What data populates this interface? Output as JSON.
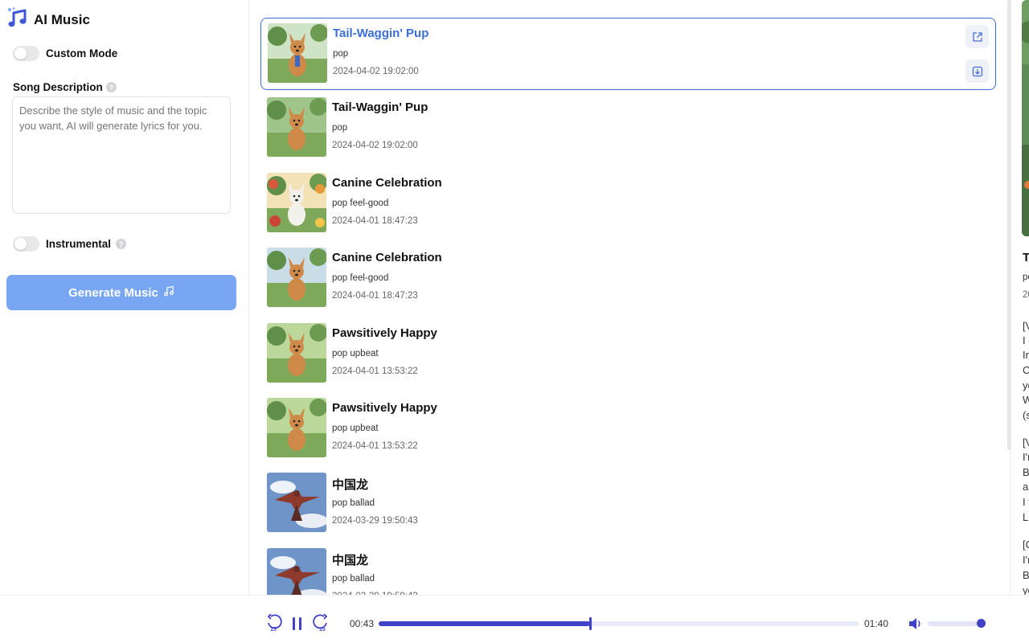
{
  "app": {
    "title": "AI Music"
  },
  "sidebar": {
    "custom_mode_label": "Custom Mode",
    "custom_mode_on": false,
    "description_label": "Song Description",
    "description_placeholder": "Describe the style of music and the topic you want, AI will generate lyrics for you.",
    "instrumental_label": "Instrumental",
    "instrumental_on": false,
    "generate_label": "Generate Music"
  },
  "songs": [
    {
      "title": "Tail-Waggin' Pup",
      "tags": "pop",
      "date": "2024-04-02 19:02:00",
      "selected": true,
      "art": "dog-park"
    },
    {
      "title": "Tail-Waggin' Pup",
      "tags": "pop",
      "date": "2024-04-02 19:02:00",
      "selected": false,
      "art": "dog-path"
    },
    {
      "title": "Canine Celebration",
      "tags": "pop feel-good",
      "date": "2024-04-01 18:47:23",
      "selected": false,
      "art": "dog-flowers"
    },
    {
      "title": "Canine Celebration",
      "tags": "pop feel-good",
      "date": "2024-04-01 18:47:23",
      "selected": false,
      "art": "dog-river"
    },
    {
      "title": "Pawsitively Happy",
      "tags": "pop upbeat",
      "date": "2024-04-01 13:53:22",
      "selected": false,
      "art": "dog-forest"
    },
    {
      "title": "Pawsitively Happy",
      "tags": "pop upbeat",
      "date": "2024-04-01 13:53:22",
      "selected": false,
      "art": "dog-forest"
    },
    {
      "title": "中国龙",
      "tags": "pop ballad",
      "date": "2024-03-29 19:50:43",
      "selected": false,
      "art": "dragon"
    },
    {
      "title": "中国龙",
      "tags": "pop ballad",
      "date": "2024-03-29 19:50:43",
      "selected": false,
      "art": "dragon"
    }
  ],
  "detail": {
    "title_fragment": "T",
    "tags_fragment": "po",
    "date_fragment": "20",
    "lyrics_fragments": [
      "[V",
      "I g",
      "In",
      "C",
      "yo",
      "W",
      "(s",
      "[V",
      "I'r",
      "B",
      "ar",
      "I f",
      "Li",
      "[C",
      "I'r",
      "B",
      "yo"
    ]
  },
  "player": {
    "elapsed": "00:43",
    "duration": "01:40",
    "progress_fraction": 0.44,
    "volume_fraction": 0.9,
    "skip_seconds": "15"
  },
  "colors": {
    "accent": "#4141c8",
    "link": "#3b6fd6",
    "button": "#79a6f2"
  }
}
